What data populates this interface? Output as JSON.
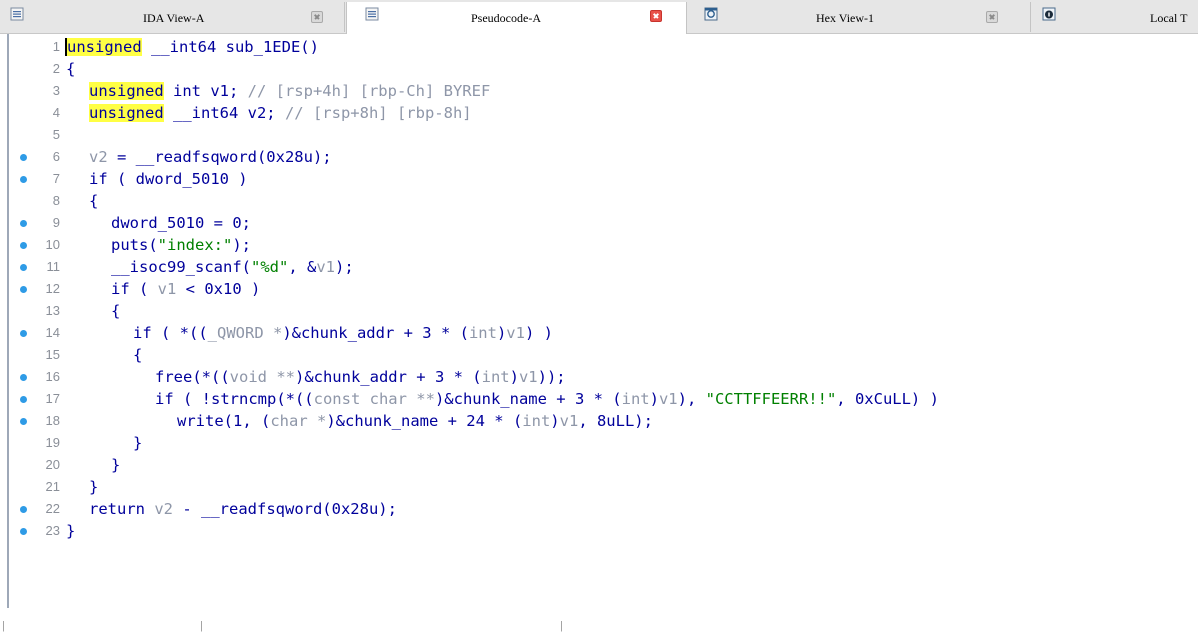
{
  "tabs": [
    {
      "label": "IDA View-A",
      "icon": "listing-icon",
      "close_style": "gray",
      "active": false
    },
    {
      "label": "Pseudocode-A",
      "icon": "listing-icon",
      "close_style": "red",
      "active": true
    },
    {
      "label": "Hex View-1",
      "icon": "hex-icon",
      "close_style": "gray",
      "active": false
    },
    {
      "label": "Local T",
      "icon": "info-icon",
      "close_style": "none",
      "active": false
    }
  ],
  "code_lines": [
    {
      "n": "1",
      "bp": false
    },
    {
      "n": "2",
      "bp": false
    },
    {
      "n": "3",
      "bp": false
    },
    {
      "n": "4",
      "bp": false
    },
    {
      "n": "5",
      "bp": false
    },
    {
      "n": "6",
      "bp": true
    },
    {
      "n": "7",
      "bp": true
    },
    {
      "n": "8",
      "bp": false
    },
    {
      "n": "9",
      "bp": true
    },
    {
      "n": "10",
      "bp": true
    },
    {
      "n": "11",
      "bp": true
    },
    {
      "n": "12",
      "bp": true
    },
    {
      "n": "13",
      "bp": false
    },
    {
      "n": "14",
      "bp": true
    },
    {
      "n": "15",
      "bp": false
    },
    {
      "n": "16",
      "bp": true
    },
    {
      "n": "17",
      "bp": true
    },
    {
      "n": "18",
      "bp": true
    },
    {
      "n": "19",
      "bp": false
    },
    {
      "n": "20",
      "bp": false
    },
    {
      "n": "21",
      "bp": false
    },
    {
      "n": "22",
      "bp": true
    },
    {
      "n": "23",
      "bp": false
    }
  ],
  "code": {
    "l1_kw": "unsigned",
    "l1_rest": " __int64 sub_1EDE()",
    "l2": "{",
    "l3_kw": "unsigned",
    "l3_rest": " int v1;",
    "l3_cmt": " // [rsp+4h] [rbp-Ch] BYREF",
    "l4_kw": "unsigned",
    "l4_rest": " __int64 v2;",
    "l4_cmt": " // [rsp+8h] [rbp-8h]",
    "l6_a": "v2",
    "l6_b": " = __readfsqword(0x28u);",
    "l7": "if ( dword_5010 )",
    "l8": "{",
    "l9": "dword_5010 = 0;",
    "l10_a": "puts(",
    "l10_str": "\"index:\"",
    "l10_b": ");",
    "l11_a": "__isoc99_scanf(",
    "l11_str": "\"%d\"",
    "l11_b": ", &",
    "l11_v": "v1",
    "l11_c": ");",
    "l12_a": "if ( ",
    "l12_v": "v1",
    "l12_b": " < 0x10 )",
    "l13": "{",
    "l14_a": "if ( *((",
    "l14_t": "_QWORD *",
    "l14_b": ")&chunk_addr + 3 * (",
    "l14_t2": "int",
    "l14_c": ")",
    "l14_v": "v1",
    "l14_d": ") )",
    "l15": "{",
    "l16_a": "free(*((",
    "l16_t": "void **",
    "l16_b": ")&chunk_addr + 3 * (",
    "l16_t2": "int",
    "l16_c": ")",
    "l16_v": "v1",
    "l16_d": "));",
    "l17_a": "if ( !strncmp(*((",
    "l17_t": "const char **",
    "l17_b": ")&chunk_name + 3 * (",
    "l17_t2": "int",
    "l17_c": ")",
    "l17_v": "v1",
    "l17_d": "), ",
    "l17_str": "\"CCTTFFEERR!!\"",
    "l17_e": ", 0xCuLL) )",
    "l18_a": "write(1, (",
    "l18_t": "char *",
    "l18_b": ")&chunk_name + 24 * (",
    "l18_t2": "int",
    "l18_c": ")",
    "l18_v": "v1",
    "l18_d": ", 8uLL);",
    "l19": "}",
    "l20": "}",
    "l21": "}",
    "l22_a": "return ",
    "l22_v": "v2",
    "l22_b": " - __readfsqword(0x28u);",
    "l23": "}"
  },
  "colors": {
    "keyword": "#00009b",
    "highlight": "#ffff44",
    "comment": "#8e96a8",
    "string": "#008000",
    "breakpoint": "#2e9be6",
    "close_red": "#e8524a"
  }
}
